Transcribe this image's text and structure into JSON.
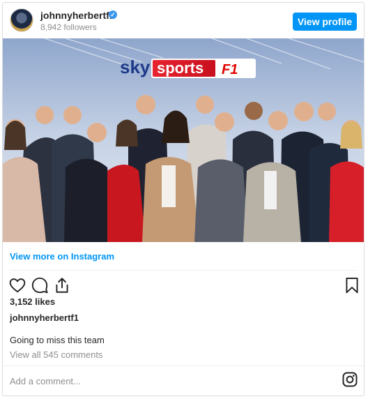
{
  "header": {
    "username": "johnnyherbertf1",
    "verified_mark": "✓",
    "followers": "8,942 followers",
    "view_profile_label": "View profile",
    "accent_color": "#0095f6"
  },
  "photo": {
    "logo_sky": "sky",
    "logo_sports": "sports",
    "logo_f1": "F1"
  },
  "post": {
    "view_more_label": "View more on Instagram",
    "likes": "3,152 likes",
    "owner": "johnnyherbertf1",
    "caption": "Going to miss this team",
    "comments_link": "View all 545 comments",
    "add_comment_placeholder": "Add a comment...",
    "icons": [
      "heart-icon",
      "comment-icon",
      "share-icon",
      "bookmark-icon",
      "instagram-icon"
    ]
  }
}
